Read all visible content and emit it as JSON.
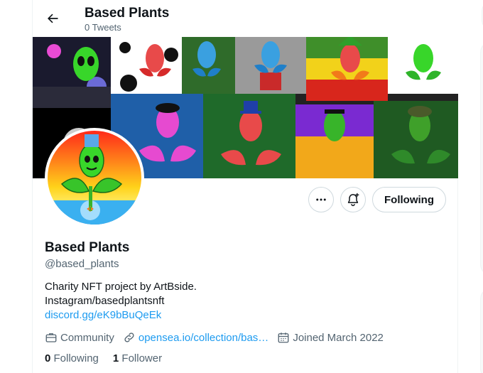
{
  "header": {
    "title": "Based Plants",
    "subtitle": "0 Tweets"
  },
  "profile": {
    "name": "Based Plants",
    "handle": "@based_plants",
    "bio_line1": "Charity NFT project by ArtBside.",
    "bio_line2": "Instagram/basedplantsnft",
    "bio_link": "discord.gg/eK9bBuQeEk",
    "category": "Community",
    "website": "opensea.io/collection/bas…",
    "joined": "Joined March 2022",
    "following_count": "0",
    "following_label": "Following",
    "followers_count": "1",
    "followers_label": "Follower"
  },
  "actions": {
    "follow_label": "Following"
  },
  "icons": {
    "back": "arrow-left-icon",
    "more": "more-icon",
    "notify": "bell-plus-icon",
    "category": "briefcase-icon",
    "website": "link-icon",
    "joined": "calendar-icon"
  },
  "colors": {
    "accent": "#1d9bf0",
    "text": "#0f1419",
    "muted": "#536471",
    "border": "#cfd9de"
  }
}
